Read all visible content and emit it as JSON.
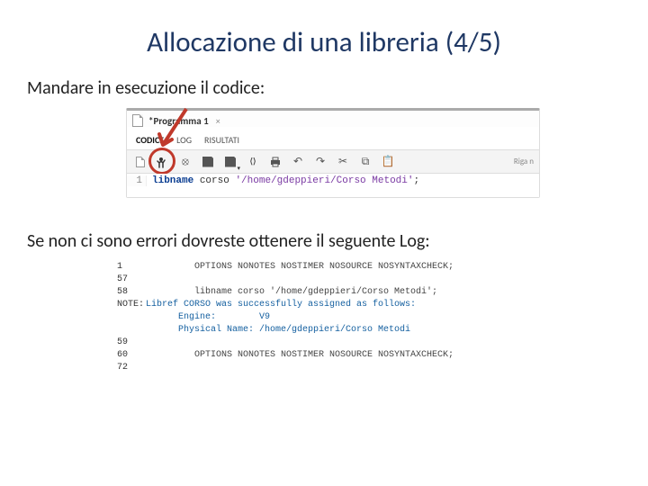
{
  "title": "Allocazione di una libreria (4/5)",
  "intro": "Mandare in esecuzione il codice:",
  "panel": {
    "tab_title": "*Programma 1",
    "tab_close": "×",
    "subtabs": {
      "code": "CODICE",
      "log": "LOG",
      "results": "RISULTATI"
    },
    "riga_label": "Riga n",
    "code": {
      "lineno": "1",
      "kw1": "libname",
      "ident": " corso ",
      "str": "'/home/gdeppieri/Corso Metodi'",
      "semi": ";"
    }
  },
  "mid_text": "Se non ci sono errori dovreste ottenere il seguente Log:",
  "log": {
    "l1_num": "1",
    "l1_txt": "         OPTIONS NONOTES NOSTIMER NOSOURCE NOSYNTAXCHECK;",
    "l2_num": "57",
    "l2_txt": "",
    "l3_num": "58",
    "l3_txt": "         libname corso '/home/gdeppieri/Corso Metodi';",
    "l4_lbl": "NOTE: ",
    "l4_txt": "Libref CORSO was successfully assigned as follows:",
    "l5_txt": "      Engine:        V9",
    "l6_txt": "      Physical Name: /home/gdeppieri/Corso Metodi",
    "l7_num": "59",
    "l7_txt": "",
    "l8_num": "60",
    "l8_txt": "         OPTIONS NONOTES NOSTIMER NOSOURCE NOSYNTAXCHECK;",
    "l9_num": "72",
    "l9_txt": ""
  }
}
